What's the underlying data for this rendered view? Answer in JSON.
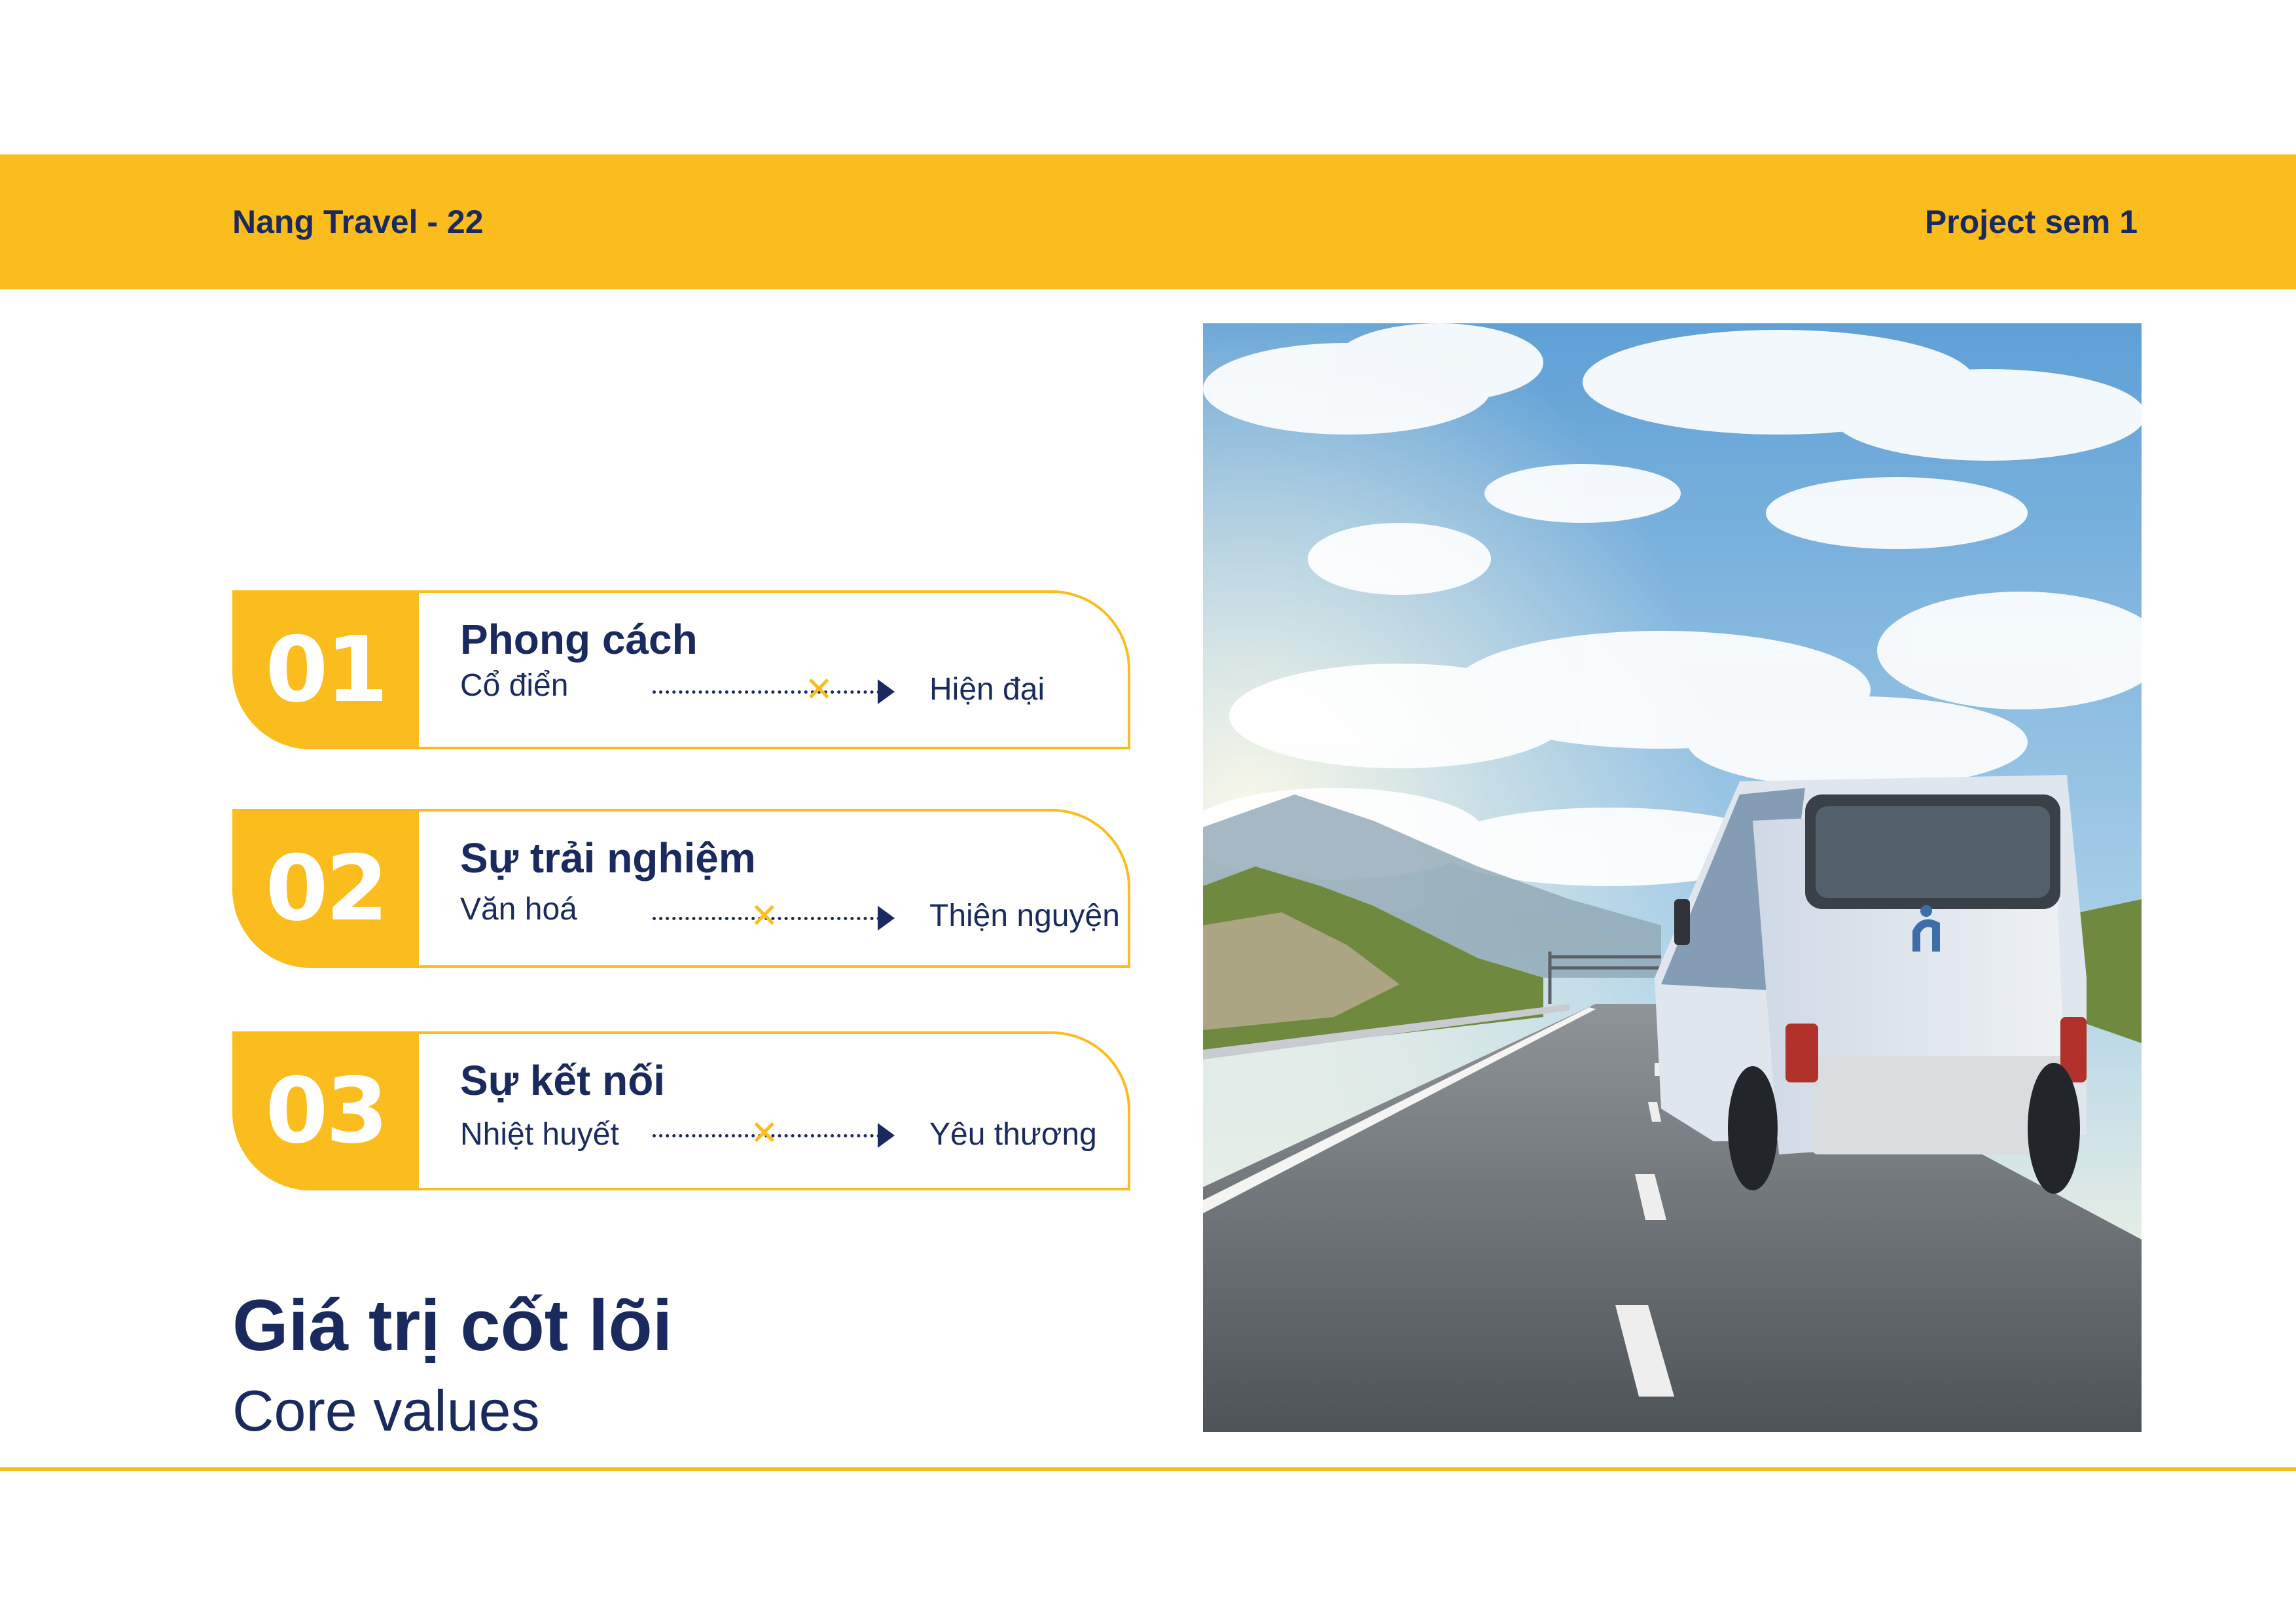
{
  "header": {
    "brand": "Nang Travel - 22",
    "project": "Project sem 1"
  },
  "values": [
    {
      "number": "01",
      "title": "Phong cách",
      "from": "Cổ điển",
      "to": "Hiện đại",
      "position": 0.72
    },
    {
      "number": "02",
      "title": "Sự trải nghiệm",
      "from": "Văn hoá",
      "to": "Thiện nguyện",
      "position": 0.48
    },
    {
      "number": "03",
      "title": "Sự kết nối",
      "from": "Nhiệt huyết",
      "to": "Yêu thương",
      "position": 0.48
    }
  ],
  "footer": {
    "heading": "Giá trị cốt lõi",
    "subheading": "Core values"
  },
  "photo": {
    "subject": "white coach bus on highway under blue sky"
  },
  "colors": {
    "accent": "#fbbd1d",
    "navy": "#1b2a5e",
    "background": "#ffffff"
  }
}
